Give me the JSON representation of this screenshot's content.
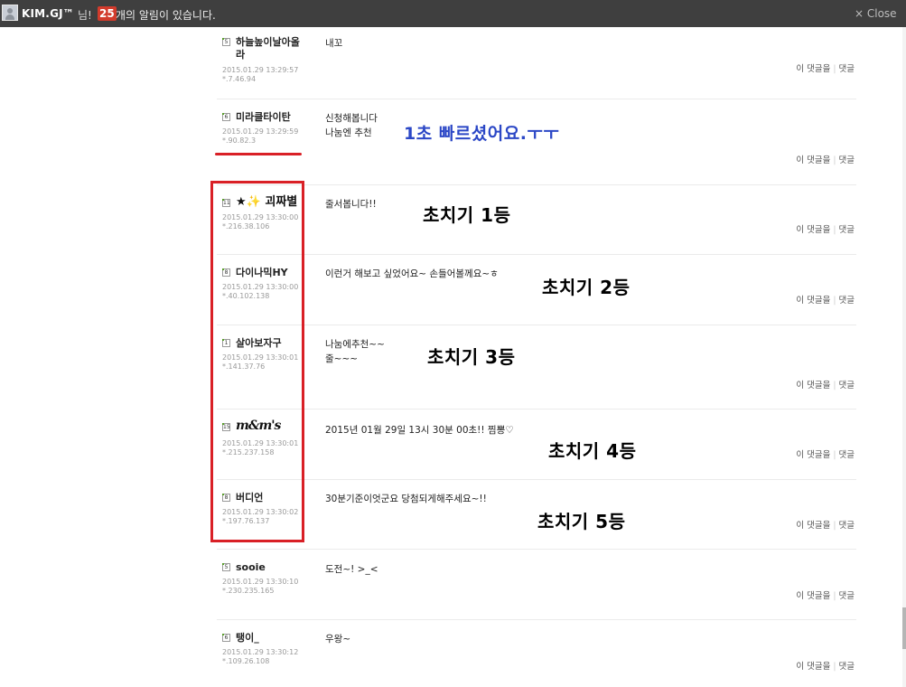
{
  "topbar": {
    "user": "KIM.GJ™",
    "suffix": "님!",
    "count": "25",
    "message": "개의 알림이 있습니다.",
    "close": "× Close"
  },
  "actions": {
    "reply_this": "이 댓글을",
    "reply": "댓글"
  },
  "comments": [
    {
      "level": "5",
      "nick": "하늘높이날아올\n라",
      "date": "2015.01.29 13:29:57",
      "ip": "*.7.46.94",
      "text": "내꼬"
    },
    {
      "level": "6",
      "nick": "미라클타이탄",
      "date": "2015.01.29 13:29:59",
      "ip": "*.90.82.3",
      "text": "신청해봅니다\n나눔엔 추천"
    },
    {
      "level": "11",
      "nick": "★✨ 괴짜별",
      "date": "2015.01.29 13:30:00",
      "ip": "*.216.38.106",
      "text": "줄서봅니다!!"
    },
    {
      "level": "8",
      "nick": "다이나믹HY",
      "date": "2015.01.29 13:30:00",
      "ip": "*.40.102.138",
      "text": "이런거 해보고 싶었어요~ 손들어볼께요~ㅎ"
    },
    {
      "level": "1",
      "nick": "살아보자구",
      "date": "2015.01.29 13:30:01",
      "ip": "*.141.37.76",
      "text": "나눔에추천~~\n줄~~~"
    },
    {
      "level": "15",
      "nick": "m&m's",
      "date": "2015.01.29 13:30:01",
      "ip": "*.215.237.158",
      "text": "2015년 01월 29일 13시 30분 00초!! 찜뽕♡"
    },
    {
      "level": "8",
      "nick": "버디언",
      "date": "2015.01.29 13:30:02",
      "ip": "*.197.76.137",
      "text": "30분기준이엇군요 당첨되게해주세요~!!"
    },
    {
      "level": "5",
      "nick": "sooie",
      "date": "2015.01.29 13:30:10",
      "ip": "*.230.235.165",
      "text": "도전~! >_<"
    },
    {
      "level": "6",
      "nick": "탱이_",
      "date": "2015.01.29 13:30:12",
      "ip": "*.109.26.108",
      "text": "우왕~"
    }
  ],
  "annotations": {
    "faster": "1초 빠르셨어요.ㅜㅜ",
    "first": "초치기 1등",
    "second": "초치기 2등",
    "third": "초치기 3등",
    "fourth": "초치기 4등",
    "fifth": "초치기 5등"
  },
  "colors": {
    "topbar": "#3f3f3f",
    "badge": "#d23b2c",
    "highlight_red": "#d92026",
    "annotation_blue": "#2b47c6"
  }
}
